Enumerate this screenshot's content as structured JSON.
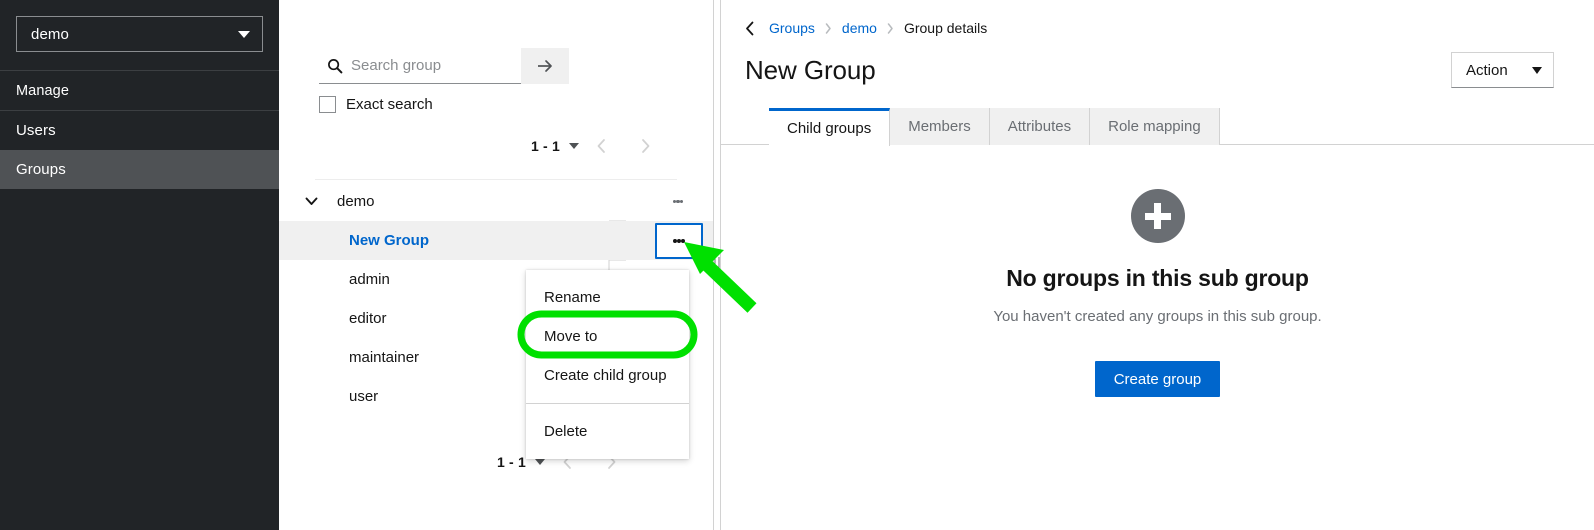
{
  "sidebar": {
    "realm_select": {
      "value": "demo",
      "icon": "chevron-down-icon"
    },
    "items": [
      {
        "label": "Manage",
        "type": "section",
        "active": false
      },
      {
        "label": "Users",
        "type": "nav",
        "active": false
      },
      {
        "label": "Groups",
        "type": "nav",
        "active": true
      }
    ]
  },
  "tree_panel": {
    "search": {
      "placeholder": "Search group",
      "value": "",
      "icon": "search-icon"
    },
    "search_button": {
      "label": "",
      "icon": "arrow-right-icon"
    },
    "exact_search": {
      "label": "Exact search",
      "checked": false
    },
    "pagination_top": {
      "count": "1 - 1",
      "prev": "‹",
      "next": "›"
    },
    "pagination_bottom": {
      "count": "1 - 1",
      "prev": "‹",
      "next": "›"
    },
    "tree": {
      "root": {
        "label": "demo",
        "expanded": true,
        "kebab": "kebab-icon"
      },
      "children": [
        {
          "label": "New Group",
          "selected": true,
          "is_link": true,
          "kebab": "kebab-icon",
          "kebab_focused": true
        },
        {
          "label": "admin",
          "selected": false,
          "is_link": false
        },
        {
          "label": "editor",
          "selected": false,
          "is_link": false
        },
        {
          "label": "maintainer",
          "selected": false,
          "is_link": false
        },
        {
          "label": "user",
          "selected": false,
          "is_link": false
        }
      ]
    }
  },
  "context_menu": {
    "items": [
      {
        "label": "Rename",
        "highlighted": false
      },
      {
        "label": "Move to",
        "highlighted": true
      },
      {
        "label": "Create child group",
        "highlighted": false
      }
    ],
    "items_after_sep": [
      {
        "label": "Delete",
        "highlighted": false
      }
    ]
  },
  "main": {
    "breadcrumb": {
      "back_icon": "chevron-left-icon",
      "items": [
        {
          "label": "Groups",
          "is_link": true
        },
        {
          "label": "demo",
          "is_link": true
        },
        {
          "label": "Group details",
          "is_link": false
        }
      ],
      "separator": "›"
    },
    "title": "New Group",
    "action_button": {
      "label": "Action",
      "icon": "caret-down-icon"
    },
    "tabs": [
      {
        "label": "Child groups",
        "active": true
      },
      {
        "label": "Members",
        "active": false
      },
      {
        "label": "Attributes",
        "active": false
      },
      {
        "label": "Role mapping",
        "active": false
      }
    ],
    "empty_state": {
      "icon": "plus-circle-icon",
      "title": "No groups in this sub group",
      "subtitle": "You haven't created any groups in this sub group.",
      "button": "Create group"
    }
  },
  "annotations": {
    "highlight_color": "#00e000",
    "focus_color": "#0066cc",
    "arrow": {
      "name": "pointer-arrow",
      "target": "tree-kebab-new-group"
    },
    "oval": {
      "name": "highlight-oval",
      "target": "menu-item-move-to"
    }
  }
}
